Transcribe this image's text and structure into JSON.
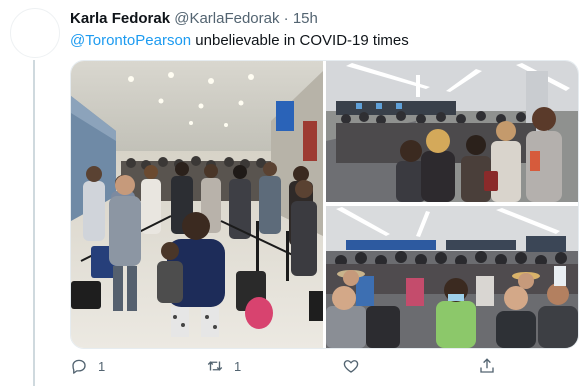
{
  "tweet": {
    "author_name": "Karla Fedorak",
    "author_handle": "@KarlaFedorak",
    "separator": "·",
    "time": "15h",
    "mention": "@TorontoPearson",
    "text": " unbelievable in COVID-19 times"
  },
  "media": {
    "photo_count": 3
  },
  "actions": {
    "reply_count": "1",
    "retweet_count": "1",
    "like_count": "",
    "share_label": ""
  },
  "colors": {
    "link": "#1d9bf0",
    "secondary_text": "#536471",
    "thread_line": "#cfd9de"
  },
  "icons": {
    "reply": "comment-icon",
    "retweet": "retweet-icon",
    "like": "heart-icon",
    "share": "share-icon"
  }
}
